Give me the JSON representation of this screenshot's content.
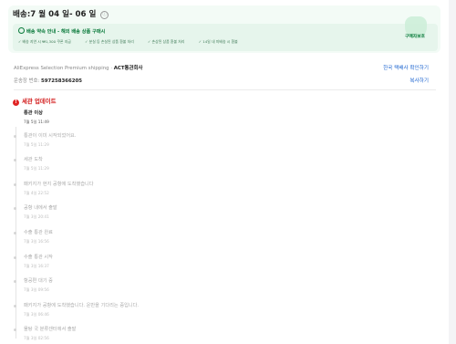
{
  "header": {
    "delivery_title": "배송:7 월 04 일- 06 일",
    "info_icon": "ⓘ",
    "guarantee_title": "배송 약속 안내 - 해외 배송 상품 구매시",
    "guarantee_items": [
      "배송 지연 시 ₩1,300 쿠폰 지급",
      "분실 등 손실된 상품 환불 처리",
      "손상된 상품 환불 처리",
      "14일 내 미배송 시 환불"
    ],
    "badge_label": "구매자보호"
  },
  "shipment": {
    "shipping_prefix": "AliExpress Selection Premium shipping · ",
    "carrier": "ACT통관회사",
    "tracking_prefix": "운송장 번호: ",
    "tracking_number": "597258366205",
    "carrier_link": "한국 택배사 확인하기",
    "copy_link": "복사하기"
  },
  "events_header": "세관 업데이트",
  "alert_icon": "!",
  "events": [
    {
      "text": "통관 이상",
      "time": "7월 5일 11:49",
      "current": true
    },
    {
      "text": "통관이 이미 시작되었어요.",
      "time": "7월 5일 11:29",
      "current": false
    },
    {
      "text": "세관 도착",
      "time": "7월 5일 11:29",
      "current": false
    },
    {
      "text": "패키지가 현지 공항에 도착했습니다",
      "time": "7월 4일 22:52",
      "current": false
    },
    {
      "text": "공항 내에서 출발",
      "time": "7월 3일 20:41",
      "current": false
    },
    {
      "text": "수출 통관 완료",
      "time": "7월 3일 16:56",
      "current": false
    },
    {
      "text": "수출 통관 시작",
      "time": "7월 3일 16:37",
      "current": false
    },
    {
      "text": "항공편 대기 중",
      "time": "7월 3일 09:56",
      "current": false
    },
    {
      "text": "패키지가 공항에 도착했습니다. 운반을 기다리는 중입니다.",
      "time": "7월 3일 06:46",
      "current": false
    },
    {
      "text": "물탕 국 분류센터에서 출발",
      "time": "7월 3일 02:56",
      "current": false
    }
  ]
}
